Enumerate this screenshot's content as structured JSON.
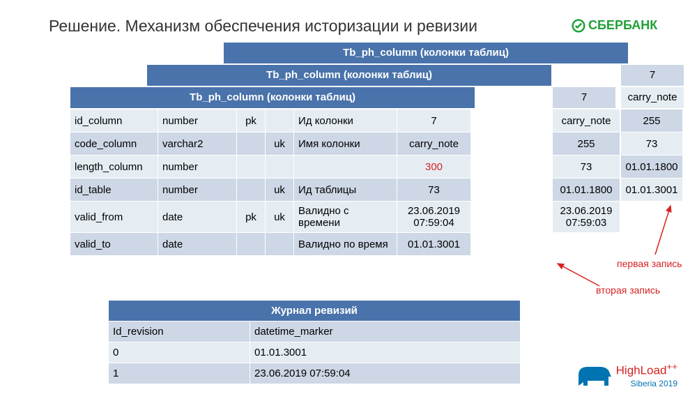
{
  "title": "Решение. Механизм обеспечения историзации и ревизии",
  "brand": "СБЕРБАНК",
  "table_header": "Tb_ph_column (колонки таблиц)",
  "layer2": {
    "col1": "7",
    "col2": "carry_note",
    "c": [
      "carry_note",
      "255",
      "73",
      "01.01.1800",
      "23.06.2019 07:59:03"
    ]
  },
  "layer3": {
    "col1": "7",
    "col2": "carry_note",
    "c": [
      "255",
      "73",
      "01.01.1800",
      "01.01.3001"
    ]
  },
  "rows": [
    {
      "a": "id_column",
      "b": "number",
      "c": "pk",
      "d": "",
      "e": "Ид колонки",
      "f": "7"
    },
    {
      "a": "code_column",
      "b": "varchar2",
      "c": "",
      "d": "uk",
      "e": "Имя колонки",
      "f": "carry_note"
    },
    {
      "a": "length_column",
      "b": "number",
      "c": "",
      "d": "",
      "e": "",
      "f": "300",
      "red": true
    },
    {
      "a": "id_table",
      "b": "number",
      "c": "",
      "d": "uk",
      "e": "Ид таблицы",
      "f": "73"
    },
    {
      "a": "valid_from",
      "b": "date",
      "c": "pk",
      "d": "uk",
      "e": "Валидно с времени",
      "f": "23.06.2019 07:59:04"
    },
    {
      "a": "valid_to",
      "b": "date",
      "c": "",
      "d": "",
      "e": "Валидно по время",
      "f": "01.01.3001"
    }
  ],
  "revision": {
    "title": "Журнал ревизий",
    "h1": "Id_revision",
    "h2": "datetime_marker",
    "rows": [
      {
        "a": "0",
        "b": "01.01.3001"
      },
      {
        "a": "1",
        "b": "23.06.2019 07:59:04"
      }
    ]
  },
  "notes": {
    "first": "первая запись",
    "second": "вторая запись"
  },
  "footer": {
    "brand1": "HighLoad",
    "brand2": "Siberia 2019"
  }
}
